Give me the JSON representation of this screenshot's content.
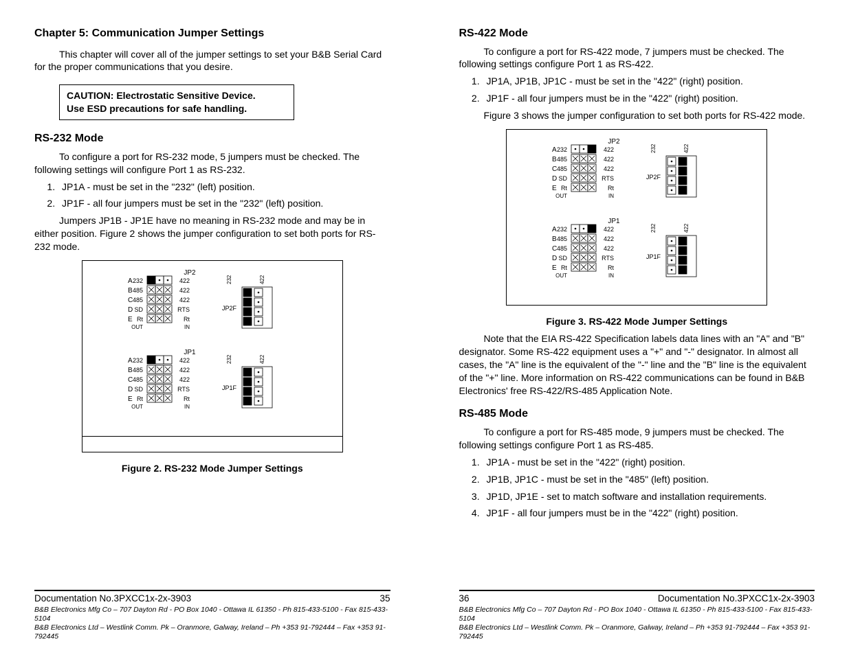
{
  "left": {
    "chapterTitle": "Chapter 5:  Communication Jumper Settings",
    "introPara": "This chapter will cover all of the jumper settings to set your B&B Serial Card for the proper communications that you desire.",
    "cautionLine1": "CAUTION: Electrostatic Sensitive Device.",
    "cautionLine2": "Use ESD precautions for safe handling.",
    "rs232Heading": "RS-232 Mode",
    "rs232Para1": "To configure a port for RS-232 mode, 5 jumpers must be checked. The following settings will configure Port 1 as RS-232.",
    "rs232List1": "JP1A - must be set in the \"232\" (left) position.",
    "rs232List2": "JP1F - all four jumpers must be set in the \"232\" (left) position.",
    "rs232Para2": "Jumpers JP1B - JP1E have no meaning in RS-232 mode and may be in either position.  Figure 2 shows the jumper configuration to set both ports for RS-232 mode.",
    "fig2Caption": "Figure 2.  RS-232 Mode Jumper Settings",
    "jumperLabels": {
      "top": "JP2",
      "bottom": "JP1",
      "sideTop": "JP2F",
      "sideBottom": "JP1F",
      "rowLetters": [
        "A",
        "B",
        "C",
        "D",
        "E"
      ],
      "leftLabels": [
        "232",
        "485",
        "485",
        "SD",
        "Rt"
      ],
      "rightLabels": [
        "422",
        "422",
        "422",
        "RTS",
        "Rt"
      ],
      "subLeft": "OUT",
      "subRight": "IN",
      "vertLeft": "232",
      "vertRight": "422"
    },
    "docNo": "Documentation No.3PXCC1x-2x-3903",
    "pageNo": "35",
    "addr1": "B&B Electronics Mfg Co – 707 Dayton Rd - PO Box 1040 - Ottawa IL 61350 - Ph 815-433-5100 - Fax 815-433-5104",
    "addr2": "B&B Electronics Ltd – Westlink Comm. Pk – Oranmore, Galway, Ireland – Ph +353 91-792444 – Fax +353 91-792445"
  },
  "right": {
    "rs422Heading": "RS-422 Mode",
    "rs422Para1": "To configure a port for RS-422 mode, 7 jumpers must be checked. The following settings configure Port 1 as RS-422.",
    "rs422List1": "JP1A, JP1B, JP1C - must be set in the \"422\" (right) position.",
    "rs422List2": "JP1F - all four jumpers must be in the \"422\" (right) position.",
    "rs422Para2": "Figure 3 shows the jumper configuration to set both ports for RS-422 mode.",
    "fig3Caption": "Figure 3.  RS-422 Mode Jumper Settings",
    "rs422Note": "Note that the EIA RS-422 Specification labels data lines with an \"A\" and \"B\" designator. Some RS-422 equipment uses a \"+\" and \"-\" designator.  In almost all cases, the \"A\" line is the equivalent of the \"-\" line and the \"B\" line is the equivalent of the \"+\" line.  More information on RS-422 communications can be found in B&B Electronics' free RS-422/RS-485 Application Note.",
    "rs485Heading": "RS-485 Mode",
    "rs485Para1": "To configure a port for RS-485 mode, 9 jumpers must be checked.  The following settings configure Port 1 as RS-485.",
    "rs485List1": "JP1A - must be set in the \"422\" (right) position.",
    "rs485List2": "JP1B, JP1C - must be set in the \"485\" (left) position.",
    "rs485List3": "JP1D, JP1E - set to match software and installation requirements.",
    "rs485List4": "JP1F - all four jumpers must be in the \"422\" (right) position.",
    "docNo": "Documentation No.3PXCC1x-2x-3903",
    "pageNo": "36",
    "addr1": "B&B Electronics Mfg Co – 707 Dayton Rd - PO Box 1040 - Ottawa IL 61350 - Ph 815-433-5100 - Fax 815-433-5104",
    "addr2": "B&B Electronics Ltd – Westlink Comm. Pk – Oranmore, Galway, Ireland – Ph +353 91-792444 – Fax +353 91-792445"
  }
}
